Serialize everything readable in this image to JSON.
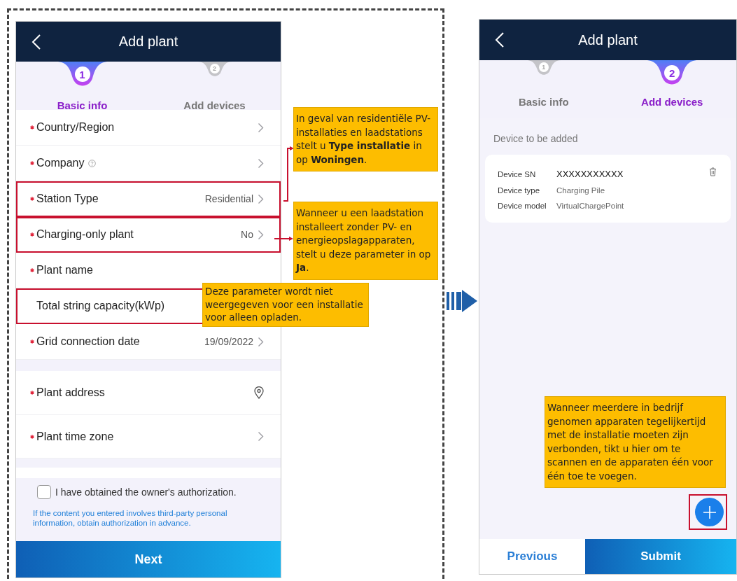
{
  "basic_info_screen": {
    "title": "Add plant",
    "steps": [
      {
        "number": "1",
        "label": "Basic info",
        "selected": true
      },
      {
        "number": "2",
        "label": "Add devices",
        "selected": false
      }
    ],
    "form_groups": [
      [
        {
          "kind": "select",
          "label": "Country/Region",
          "required": true,
          "highlighted": false
        },
        {
          "kind": "select",
          "label": "Company",
          "required": true,
          "help": true,
          "highlighted": false
        },
        {
          "kind": "select",
          "label": "Station Type",
          "required": true,
          "value": "Residential",
          "highlighted": true
        },
        {
          "kind": "select",
          "label": "Charging-only plant",
          "required": true,
          "value": "No",
          "highlighted": true
        },
        {
          "kind": "text",
          "label": "Plant name",
          "required": true,
          "highlighted": false
        },
        {
          "kind": "text",
          "label": "Total string capacity(kWp)",
          "required": false,
          "highlighted": true
        },
        {
          "kind": "select",
          "label": "Grid connection date",
          "required": true,
          "value": "19/09/2022",
          "highlighted": false
        }
      ],
      [
        {
          "kind": "location",
          "label": "Plant address",
          "required": true,
          "highlighted": false
        },
        {
          "kind": "select",
          "label": "Plant time zone",
          "required": true,
          "highlighted": false
        }
      ]
    ],
    "authorization": {
      "checked": false,
      "label": "I have obtained the owner's authorization.",
      "notice": "If the content you entered involves third-party personal information, obtain authorization in advance."
    },
    "next_button": "Next"
  },
  "add_devices_screen": {
    "title": "Add plant",
    "steps": [
      {
        "number": "1",
        "label": "Basic info",
        "selected": false
      },
      {
        "number": "2",
        "label": "Add devices",
        "selected": true
      }
    ],
    "section_label": "Device to be added",
    "device": {
      "fields": [
        {
          "label": "Device SN",
          "value": "XXXXXXXXXXX",
          "emphasized": true
        },
        {
          "label": "Device type",
          "value": "Charging Pile",
          "emphasized": false
        },
        {
          "label": "Device model",
          "value": "VirtualChargePoint",
          "emphasized": false
        }
      ]
    },
    "add_button": {
      "highlighted": true
    },
    "buttons": [
      {
        "kind": "secondary",
        "label": "Previous"
      },
      {
        "kind": "primary",
        "label": "Submit"
      }
    ]
  },
  "callouts": [
    {
      "text": "In geval van residentiële PV-installaties en laadstations stelt u **Type installatie** in op **Woningen**."
    },
    {
      "text": "Wanneer u een laadstation installeert zonder PV- en energieopslagapparaten, stelt u deze parameter in op **Ja**."
    },
    {
      "text": "Deze parameter wordt niet weergegeven voor een installatie voor alleen opladen."
    },
    {
      "text": "Wanneer meerdere in bedrijf genomen apparaten tegelijkertijd met de installatie moeten zijn verbonden, tikt u hier om te scannen en de apparaten één voor één toe te voegen."
    }
  ]
}
